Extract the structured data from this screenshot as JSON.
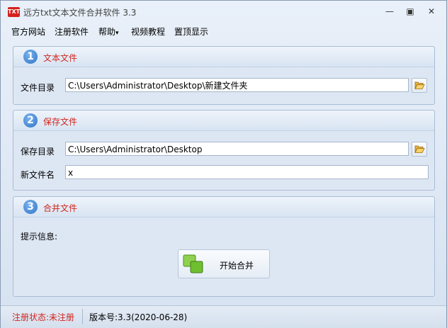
{
  "window": {
    "title": "远方txt文本文件合并软件 3.3",
    "icon_text": "TXT",
    "controls": {
      "minimize": "—",
      "maximize": "▣",
      "close": "✕"
    }
  },
  "menu": {
    "items": [
      "官方网站",
      "注册软件",
      "帮助",
      "视频教程",
      "置顶显示"
    ],
    "help_arrow": "▾"
  },
  "section1": {
    "number": "1",
    "title": "文本文件",
    "dir_label": "文件目录",
    "dir_value": "C:\\Users\\Administrator\\Desktop\\新建文件夹"
  },
  "section2": {
    "number": "2",
    "title": "保存文件",
    "dir_label": "保存目录",
    "dir_value": "C:\\Users\\Administrator\\Desktop",
    "filename_label": "新文件名",
    "filename_value": "x"
  },
  "section3": {
    "number": "3",
    "title": "合并文件",
    "info_label": "提示信息:",
    "merge_button": "开始合并"
  },
  "status": {
    "registration": "注册状态:未注册",
    "version": "版本号:3.3(2020-06-28)"
  },
  "colors": {
    "accent_red": "#d1261d",
    "step_blue": "#2f74c7",
    "panel_bg": "#dde7f3"
  }
}
